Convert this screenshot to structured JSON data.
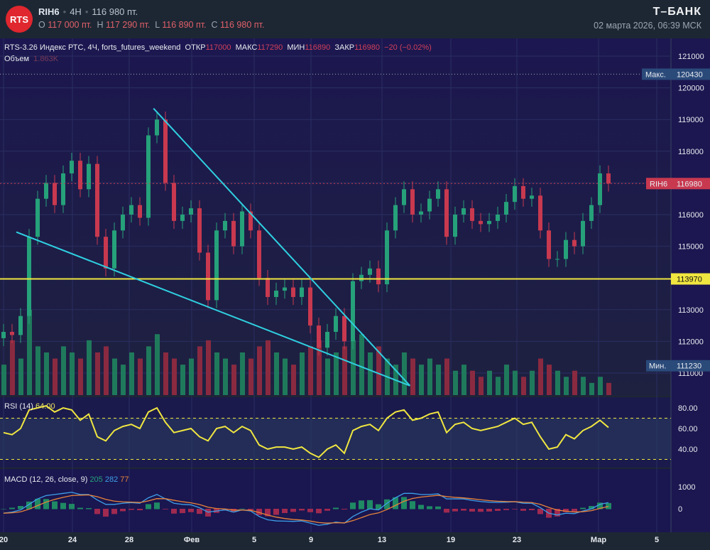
{
  "header": {
    "logo_text": "RTS",
    "symbol": "RIH6",
    "timeframe": "4H",
    "price": "116 980 пт.",
    "o_label": "O",
    "o": "117 000 пт.",
    "h_label": "H",
    "h": "117 290 пт.",
    "l_label": "L",
    "l": "116 890 пт.",
    "c_label": "C",
    "c": "116 980 пт.",
    "brand": "Т–БАНК",
    "datetime": "02 марта 2026, 06:39 МСК"
  },
  "legend": {
    "title": "RTS-3.26 Индекс РТС, 4Ч, forts_futures_weekend",
    "open_label": "ОТКР",
    "open": "117000",
    "high_label": "МАКС",
    "high": "117290",
    "low_label": "МИН",
    "low": "116890",
    "close_label": "ЗАКР",
    "close": "116980",
    "change": "−20 (−0.02%)",
    "volume_label": "Объем",
    "volume": "1.863K"
  },
  "rsi": {
    "label": "RSI (14)",
    "value": "64.00",
    "ticks": [
      "80.00",
      "60.00",
      "40.00"
    ]
  },
  "macd": {
    "label": "MACD (12, 26, close, 9)",
    "hist": "205",
    "macd": "282",
    "signal": "77",
    "ticks": [
      "1000",
      "0"
    ]
  },
  "price_axis": {
    "ticks": [
      "121000",
      "120000",
      "119000",
      "118000",
      "117000",
      "116000",
      "115000",
      "113000",
      "112000",
      "111000"
    ],
    "max_label": "Макс.",
    "max_value": "120430",
    "min_label": "Мин.",
    "min_value": "111230",
    "last_label": "RIH6",
    "last_value": "116980",
    "level_value": "113970"
  },
  "date_axis": [
    "20",
    "24",
    "28",
    "Фев",
    "5",
    "9",
    "13",
    "19",
    "23",
    "Мар",
    "5"
  ],
  "colors": {
    "up": "#26a17a",
    "down": "#c8394f",
    "trendline": "#2fd0e0",
    "level": "#f0e640",
    "rsi": "#f0e640",
    "macd": "#3d9fe8",
    "signal": "#e8843a",
    "bg": "#1c1750"
  },
  "chart_data": {
    "type": "candlestick",
    "closes": [
      112300,
      112200,
      112800,
      115300,
      116500,
      117000,
      116300,
      117300,
      117700,
      116800,
      117600,
      115300,
      114300,
      115500,
      116000,
      116300,
      115900,
      118500,
      119000,
      117000,
      115800,
      116000,
      116200,
      114800,
      113300,
      115500,
      115800,
      115000,
      116100,
      115500,
      114000,
      113400,
      113600,
      113700,
      113400,
      113700,
      112500,
      111800,
      112300,
      112800,
      112000,
      113900,
      114100,
      114300,
      113800,
      115500,
      116300,
      116800,
      116000,
      116100,
      116500,
      116800,
      115300,
      116000,
      116200,
      115800,
      115700,
      115800,
      116000,
      116400,
      116900,
      116500,
      116600,
      115500,
      114600,
      114600,
      115200,
      115000,
      115800,
      116300,
      117300,
      116980
    ],
    "volumes": [
      5,
      9,
      6,
      14,
      8,
      7,
      6,
      8,
      7,
      6,
      9,
      7,
      8,
      6,
      5,
      7,
      6,
      8,
      10,
      7,
      6,
      5,
      6,
      8,
      9,
      7,
      6,
      5,
      7,
      6,
      8,
      9,
      7,
      6,
      5,
      7,
      8,
      9,
      6,
      7,
      8,
      9,
      10,
      7,
      8,
      6,
      5,
      7,
      6,
      5,
      6,
      5,
      6,
      4,
      5,
      4,
      3,
      4,
      3,
      5,
      4,
      3,
      4,
      6,
      5,
      4,
      3,
      4,
      3,
      2,
      3,
      2
    ],
    "rsi": [
      56,
      54,
      60,
      78,
      80,
      82,
      76,
      80,
      78,
      68,
      74,
      52,
      48,
      58,
      62,
      64,
      60,
      76,
      80,
      66,
      56,
      58,
      60,
      52,
      48,
      60,
      62,
      56,
      62,
      58,
      44,
      40,
      42,
      42,
      40,
      42,
      36,
      32,
      40,
      44,
      36,
      58,
      62,
      64,
      58,
      70,
      76,
      78,
      68,
      70,
      74,
      76,
      56,
      64,
      66,
      60,
      58,
      60,
      62,
      66,
      70,
      64,
      66,
      52,
      40,
      42,
      54,
      50,
      58,
      62,
      68,
      61
    ],
    "macd": [
      -200,
      -150,
      -50,
      200,
      450,
      600,
      650,
      700,
      750,
      650,
      650,
      400,
      200,
      200,
      250,
      280,
      250,
      500,
      650,
      450,
      250,
      200,
      180,
      50,
      -150,
      -100,
      -50,
      -150,
      -50,
      -100,
      -350,
      -500,
      -550,
      -560,
      -570,
      -550,
      -650,
      -750,
      -700,
      -600,
      -650,
      -350,
      -150,
      0,
      -50,
      250,
      500,
      700,
      700,
      650,
      650,
      680,
      450,
      450,
      450,
      380,
      330,
      300,
      290,
      300,
      320,
      250,
      250,
      50,
      -200,
      -280,
      -200,
      -220,
      -100,
      0,
      200,
      282
    ],
    "level": 113970,
    "last": 116980,
    "max": 120430,
    "min": 111230,
    "trendlines": [
      {
        "from": [
          1.5,
          115450
        ],
        "to": [
          47.7,
          110600
        ]
      },
      {
        "from": [
          17.6,
          119350
        ],
        "to": [
          47.7,
          110600
        ]
      }
    ]
  }
}
